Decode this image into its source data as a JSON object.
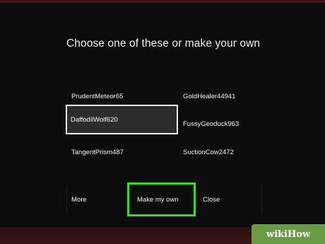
{
  "dialog": {
    "title": "Choose one of these or make your own",
    "options": [
      {
        "label": "PrudentMeteor65",
        "selected": false
      },
      {
        "label": "GoldHealer44941",
        "selected": false
      },
      {
        "label": "DaffodilWolf620",
        "selected": true
      },
      {
        "label": "FussyGeoduck963",
        "selected": false
      },
      {
        "label": "TangentPrism487",
        "selected": false
      },
      {
        "label": "SuctionCow2472",
        "selected": false
      }
    ],
    "actions": {
      "more": "More",
      "make_my_own": "Make my own",
      "close": "Close"
    }
  },
  "colors": {
    "background": "#0c0c0c",
    "highlight_border": "#3ed82b",
    "selected_border": "#ffffff",
    "watermark": "#6b9a45"
  },
  "watermark": {
    "text": "wikiHow"
  }
}
